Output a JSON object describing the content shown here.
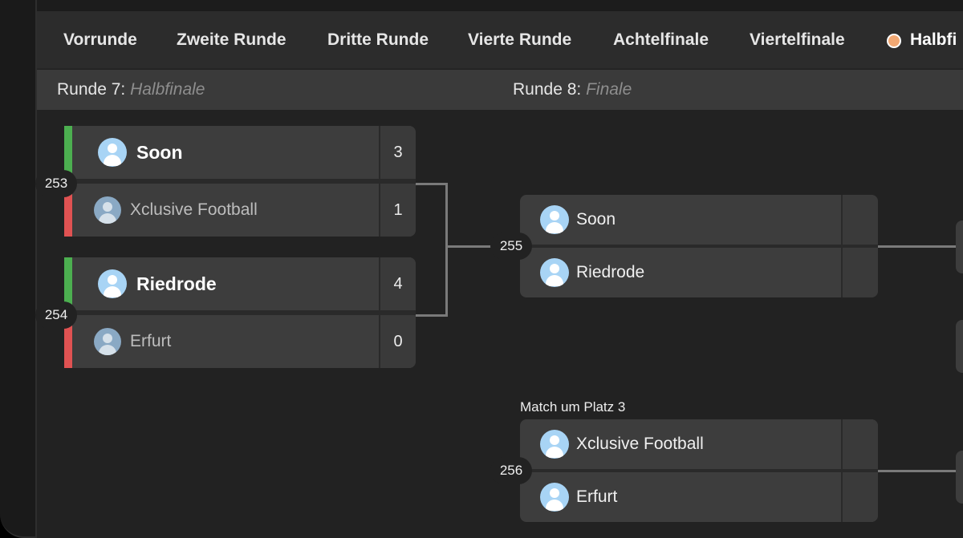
{
  "tabs": [
    {
      "label": "Vorrunde"
    },
    {
      "label": "Zweite Runde"
    },
    {
      "label": "Dritte Runde"
    },
    {
      "label": "Vierte Runde"
    },
    {
      "label": "Achtelfinale"
    },
    {
      "label": "Viertelfinale"
    },
    {
      "label": "Halbfi",
      "active": true
    }
  ],
  "rounds": [
    {
      "prefix": "Runde 7:",
      "name": "Halbfinale"
    },
    {
      "prefix": "Runde 8:",
      "name": "Finale"
    }
  ],
  "matches": [
    {
      "number": "253",
      "top": {
        "name": "Soon",
        "score": "3",
        "result": "win"
      },
      "bottom": {
        "name": "Xclusive Football",
        "score": "1",
        "result": "loss"
      }
    },
    {
      "number": "254",
      "top": {
        "name": "Riedrode",
        "score": "4",
        "result": "win"
      },
      "bottom": {
        "name": "Erfurt",
        "score": "0",
        "result": "loss"
      }
    },
    {
      "number": "255",
      "top": {
        "name": "Soon",
        "score": ""
      },
      "bottom": {
        "name": "Riedrode",
        "score": ""
      }
    },
    {
      "number": "256",
      "label": "Match um Platz 3",
      "top": {
        "name": "Xclusive Football",
        "score": ""
      },
      "bottom": {
        "name": "Erfurt",
        "score": ""
      }
    }
  ],
  "colors": {
    "win_strip": "#4caf50",
    "loss_strip": "#e05252",
    "active_tab_dot": "#f2a873",
    "avatar": "#a8d4f5"
  },
  "icons": {
    "avatar": "user-avatar-icon",
    "active_dot": "active-round-dot-icon"
  }
}
